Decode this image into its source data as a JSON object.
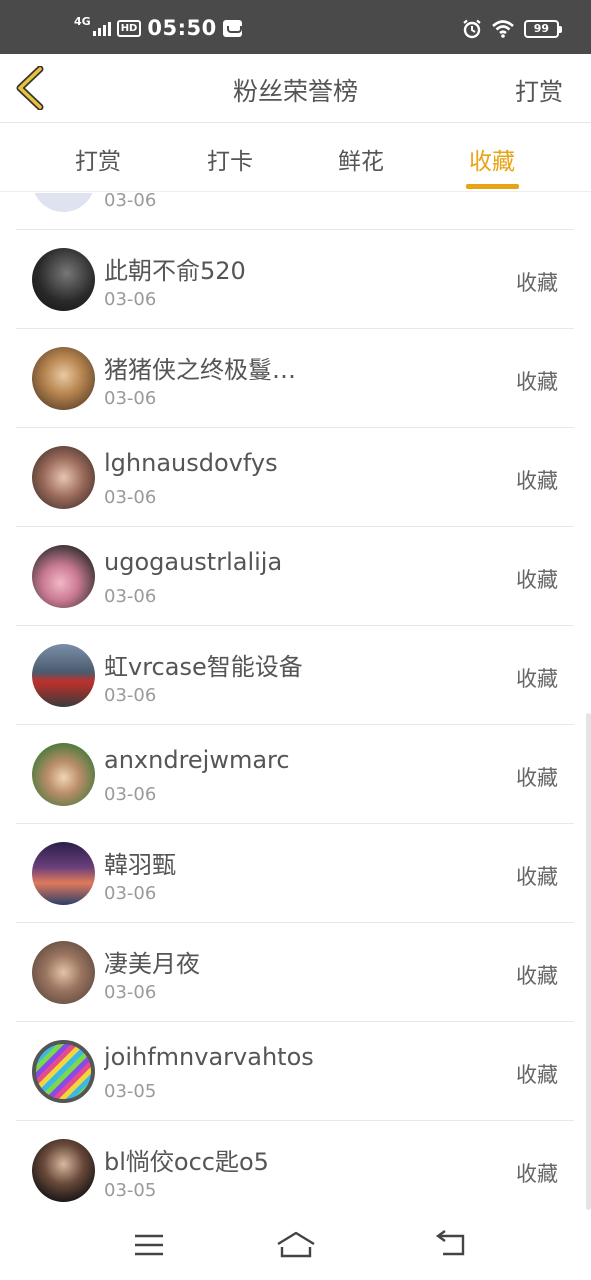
{
  "status_bar": {
    "network": "4G",
    "hd": "HD",
    "time": "05:50",
    "battery": "99",
    "icons": [
      "signal-icon",
      "app-notification-icon",
      "alarm-icon",
      "wifi-icon",
      "battery-icon"
    ]
  },
  "header": {
    "title": "粉丝荣誉榜",
    "action_label": "打赏",
    "back_icon": "chevron-left-icon",
    "accent_color": "#e8a317"
  },
  "tabs": [
    {
      "label": "打赏",
      "active": false
    },
    {
      "label": "打卡",
      "active": false
    },
    {
      "label": "鲜花",
      "active": false
    },
    {
      "label": "收藏",
      "active": true
    }
  ],
  "list": {
    "items": [
      {
        "name": "",
        "date": "03-06",
        "action": "",
        "avatar": "partial-avatar"
      },
      {
        "name": "此朝不俞520",
        "date": "03-06",
        "action": "收藏",
        "avatar": "avatar"
      },
      {
        "name": "猪猪侠之终极鬘…",
        "date": "03-06",
        "action": "收藏",
        "avatar": "avatar"
      },
      {
        "name": "lghnausdovfys",
        "date": "03-06",
        "action": "收藏",
        "avatar": "avatar"
      },
      {
        "name": "ugogaustrlalija",
        "date": "03-06",
        "action": "收藏",
        "avatar": "avatar"
      },
      {
        "name": "虹vrcase智能设备",
        "date": "03-06",
        "action": "收藏",
        "avatar": "avatar"
      },
      {
        "name": "anxndrejwmarc",
        "date": "03-06",
        "action": "收藏",
        "avatar": "avatar"
      },
      {
        "name": "韓羽甄",
        "date": "03-06",
        "action": "收藏",
        "avatar": "avatar"
      },
      {
        "name": "凄美月夜",
        "date": "03-06",
        "action": "收藏",
        "avatar": "avatar"
      },
      {
        "name": "joihfmnvarvahtos",
        "date": "03-05",
        "action": "收藏",
        "avatar": "avatar"
      },
      {
        "name": "bl惝佼occ匙o5",
        "date": "03-05",
        "action": "收藏",
        "avatar": "avatar"
      }
    ]
  },
  "nav_bar": {
    "icons": [
      "menu-icon",
      "home-icon",
      "back-icon"
    ]
  }
}
